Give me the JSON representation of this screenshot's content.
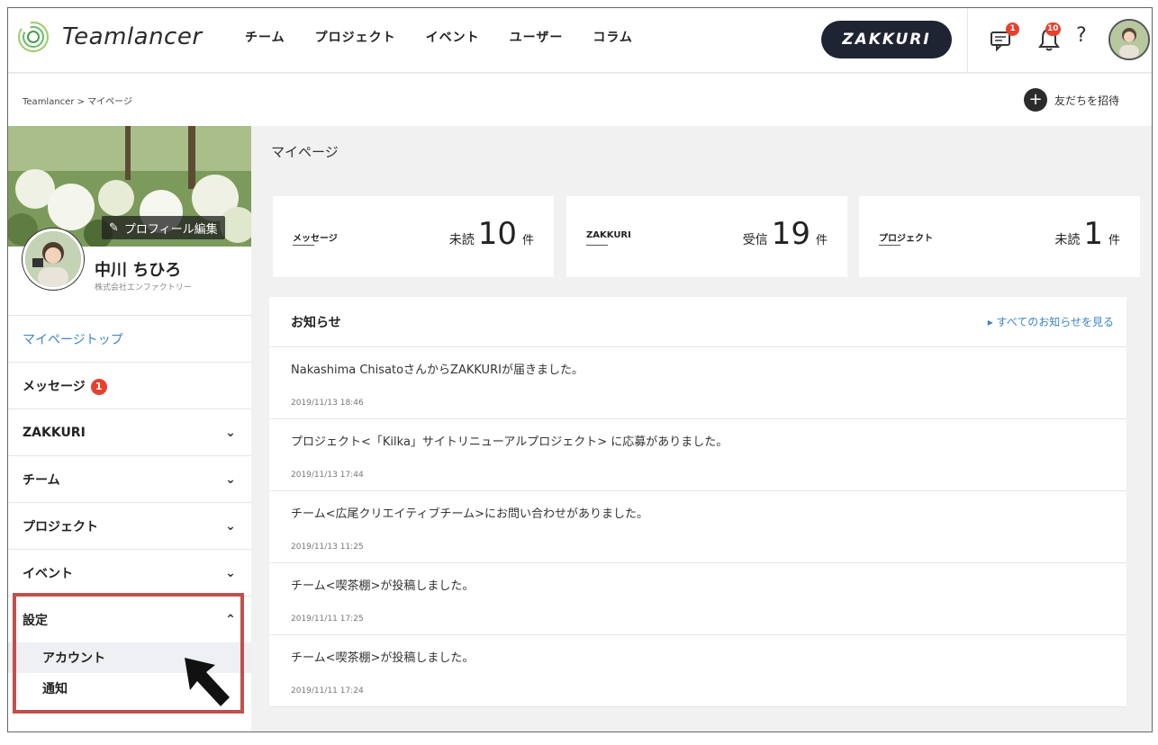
{
  "header": {
    "logo_text": "Teamlancer",
    "nav": [
      "チーム",
      "プロジェクト",
      "イベント",
      "ユーザー",
      "コラム"
    ],
    "zakkuri_label": "ZAKKURI",
    "message_badge": "1",
    "notification_badge": "10",
    "help_label": "?"
  },
  "breadcrumb": "Teamlancer > マイページ",
  "invite_label": "友だちを招待",
  "profile": {
    "edit_label": "プロフィール編集",
    "name": "中川 ちひろ",
    "company": "株式会社エンファクトリー"
  },
  "sidebar": {
    "items": [
      {
        "label": "マイページトップ"
      },
      {
        "label": "メッセージ",
        "badge": "1"
      },
      {
        "label": "ZAKKURI"
      },
      {
        "label": "チーム"
      },
      {
        "label": "プロジェクト"
      },
      {
        "label": "イベント"
      },
      {
        "label": "設定"
      }
    ],
    "sub_items": [
      "アカウント",
      "通知"
    ]
  },
  "main": {
    "title": "マイページ",
    "stats": [
      {
        "label": "メッセージ",
        "prefix": "未読",
        "value": "10",
        "unit": "件"
      },
      {
        "label": "ZAKKURI",
        "prefix": "受信",
        "value": "19",
        "unit": "件"
      },
      {
        "label": "プロジェクト",
        "prefix": "未読",
        "value": "1",
        "unit": "件"
      }
    ],
    "news_title": "お知らせ",
    "news_all": "▸ すべてのお知らせを見る",
    "news": [
      {
        "text": "Nakashima ChisatoさんからZAKKURIが届きました。",
        "date": "2019/11/13 18:46"
      },
      {
        "text": "プロジェクト<「Kilka」サイトリニューアルプロジェクト> に応募がありました。",
        "date": "2019/11/13 17:44"
      },
      {
        "text": "チーム<広尾クリエイティブチーム>にお問い合わせがありました。",
        "date": "2019/11/13 11:25"
      },
      {
        "text": "チーム<喫茶棚>が投稿しました。",
        "date": "2019/11/11 17:25"
      },
      {
        "text": "チーム<喫茶棚>が投稿しました。",
        "date": "2019/11/11 17:24"
      }
    ]
  },
  "colors": {
    "accent": "#3d85c6",
    "dark_button": "#1f2433",
    "badge": "#e8402e",
    "highlight": "#c0504d"
  }
}
